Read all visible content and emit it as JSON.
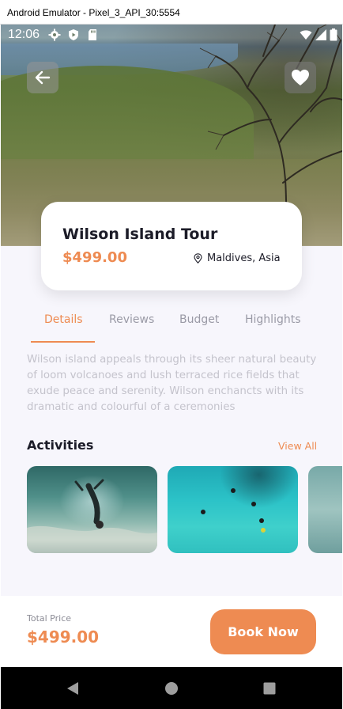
{
  "emulator": {
    "title": "Android Emulator - Pixel_3_API_30:5554"
  },
  "status_bar": {
    "time": "12:06",
    "left_icons": [
      "settings-icon",
      "shield-play-icon",
      "sd-card-icon"
    ],
    "right_icons": [
      "wifi-icon",
      "signal-icon",
      "battery-icon"
    ]
  },
  "hero": {
    "image": "coastal hill landscape with tree"
  },
  "tour": {
    "title": "Wilson Island Tour",
    "price": "$499.00",
    "location": "Maldives, Asia"
  },
  "tabs": [
    {
      "label": "Details",
      "active": true
    },
    {
      "label": "Reviews",
      "active": false
    },
    {
      "label": "Budget",
      "active": false
    },
    {
      "label": "Highlights",
      "active": false
    }
  ],
  "description": "Wilson island appeals through its sheer natural beauty of loom volcanoes and lush terraced rice fields that exude peace and  serenity. Wilson enchancts with its dramatic and colourful of a ceremonies",
  "activities": {
    "title": "Activities",
    "view_all": "View All",
    "items": [
      "underwater diving",
      "snorkeling in turquoise water",
      "sea activity"
    ]
  },
  "footer": {
    "total_label": "Total Price",
    "total_price": "$499.00",
    "book_label": "Book Now"
  },
  "colors": {
    "accent": "#ee8b52",
    "text": "#1c1c28",
    "muted": "#9a9aa6",
    "background": "#f7f6fc"
  }
}
